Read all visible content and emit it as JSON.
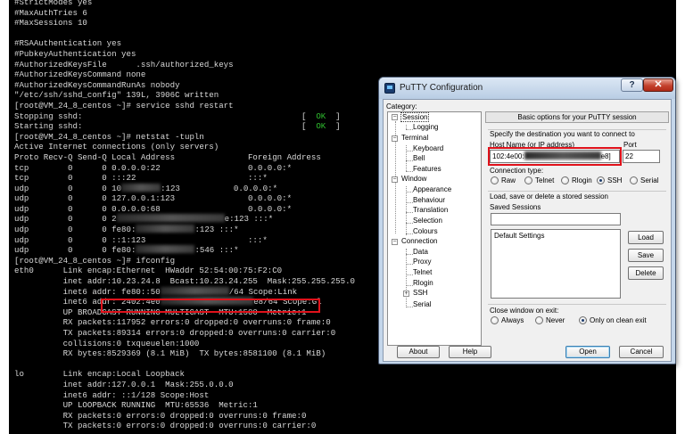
{
  "terminal": {
    "lines": [
      {
        "segs": [
          {
            "t": "#StrictModes yes"
          }
        ]
      },
      {
        "segs": [
          {
            "t": "#MaxAuthTries 6"
          }
        ]
      },
      {
        "segs": [
          {
            "t": "#MaxSessions 10"
          }
        ]
      },
      {
        "segs": [
          {
            "t": ""
          }
        ]
      },
      {
        "segs": [
          {
            "t": "#RSAAuthentication yes"
          }
        ]
      },
      {
        "segs": [
          {
            "t": "#PubkeyAuthentication yes"
          }
        ]
      },
      {
        "segs": [
          {
            "t": "#AuthorizedKeysFile      .ssh/authorized_keys"
          }
        ]
      },
      {
        "segs": [
          {
            "t": "#AuthorizedKeysCommand none"
          }
        ]
      },
      {
        "segs": [
          {
            "t": "#AuthorizedKeysCommandRunAs nobody"
          }
        ]
      },
      {
        "segs": [
          {
            "t": "\"/etc/ssh/sshd_config\" 139L, 3906C written"
          }
        ]
      },
      {
        "segs": [
          {
            "t": "[root@VM_24_8_centos ~]# service sshd restart"
          }
        ]
      },
      {
        "segs": [
          {
            "t": "Stopping sshd:                                             [  "
          },
          {
            "t": "OK",
            "ok": true
          },
          {
            "t": "  ]"
          }
        ]
      },
      {
        "segs": [
          {
            "t": "Starting sshd:                                             [  "
          },
          {
            "t": "OK",
            "ok": true
          },
          {
            "t": "  ]"
          }
        ]
      },
      {
        "segs": [
          {
            "t": "[root@VM_24_8_centos ~]# netstat -tupln"
          }
        ]
      },
      {
        "segs": [
          {
            "t": "Active Internet connections (only servers)"
          }
        ]
      },
      {
        "segs": [
          {
            "t": "Proto Recv-Q Send-Q Local Address               Foreign Address"
          }
        ]
      },
      {
        "segs": [
          {
            "t": "tcp        0      0 0.0.0.0:22                  0.0.0.0:*"
          }
        ]
      },
      {
        "segs": [
          {
            "t": "tcp        0      0 :::22                       :::*"
          }
        ]
      },
      {
        "segs": [
          {
            "t": "udp        0      0 10"
          },
          {
            "blur": 8
          },
          {
            "t": ":123           0.0.0.0:*"
          }
        ]
      },
      {
        "segs": [
          {
            "t": "udp        0      0 127.0.0.1:123               0.0.0.0:*"
          }
        ]
      },
      {
        "segs": [
          {
            "t": "udp        0      0 0.0.0.0:68                  0.0.0.0:*"
          }
        ]
      },
      {
        "segs": [
          {
            "t": "udp        0      0 2"
          },
          {
            "blur": 22
          },
          {
            "t": "e:123 :::*"
          }
        ]
      },
      {
        "segs": [
          {
            "t": "udp        0      0 fe80:"
          },
          {
            "blur": 12
          },
          {
            "t": ":123 :::*"
          }
        ]
      },
      {
        "segs": [
          {
            "t": "udp        0      0 ::1:123                     :::*"
          }
        ]
      },
      {
        "segs": [
          {
            "t": "udp        0      0 fe80:"
          },
          {
            "blur": 12
          },
          {
            "t": ":546 :::*"
          }
        ]
      },
      {
        "segs": [
          {
            "t": "[root@VM_24_8_centos ~]# ifconfig"
          }
        ]
      },
      {
        "segs": [
          {
            "t": "eth0      Link encap:Ethernet  HWaddr 52:54:00:75:F2:C0"
          }
        ]
      },
      {
        "segs": [
          {
            "t": "          inet addr:10.23.24.8  Bcast:10.23.24.255  Mask:255.255.255.0"
          }
        ]
      },
      {
        "segs": [
          {
            "t": "          inet6 addr: fe80::50"
          },
          {
            "blur": 14
          },
          {
            "t": "/64 Scope:Link"
          }
        ]
      },
      {
        "segs": [
          {
            "t": "          inet6 addr: 2402:4e0"
          },
          {
            "blur": 19
          },
          {
            "t": "e8/64 Scope:Gl"
          }
        ]
      },
      {
        "segs": [
          {
            "t": "          UP BROADCAST RUNNING MULTICAST  MTU:1500  Metric:1"
          }
        ]
      },
      {
        "segs": [
          {
            "t": "          RX packets:117952 errors:0 dropped:0 overruns:0 frame:0"
          }
        ]
      },
      {
        "segs": [
          {
            "t": "          TX packets:89314 errors:0 dropped:0 overruns:0 carrier:0"
          }
        ]
      },
      {
        "segs": [
          {
            "t": "          collisions:0 txqueuelen:1000"
          }
        ]
      },
      {
        "segs": [
          {
            "t": "          RX bytes:8529369 (8.1 MiB)  TX bytes:8581100 (8.1 MiB)"
          }
        ]
      },
      {
        "segs": [
          {
            "t": ""
          }
        ]
      },
      {
        "segs": [
          {
            "t": "lo        Link encap:Local Loopback"
          }
        ]
      },
      {
        "segs": [
          {
            "t": "          inet addr:127.0.0.1  Mask:255.0.0.0"
          }
        ]
      },
      {
        "segs": [
          {
            "t": "          inet6 addr: ::1/128 Scope:Host"
          }
        ]
      },
      {
        "segs": [
          {
            "t": "          UP LOOPBACK RUNNING  MTU:65536  Metric:1"
          }
        ]
      },
      {
        "segs": [
          {
            "t": "          RX packets:0 errors:0 dropped:0 overruns:0 frame:0"
          }
        ]
      },
      {
        "segs": [
          {
            "t": "          TX packets:0 errors:0 dropped:0 overruns:0 carrier:0"
          }
        ]
      }
    ]
  },
  "putty": {
    "title": "PuTTY Configuration",
    "help_glyph": "?",
    "close_glyph": "✕",
    "category_label": "Category:",
    "tree": {
      "session": "Session",
      "logging": "Logging",
      "terminal": "Terminal",
      "keyboard": "Keyboard",
      "bell": "Bell",
      "features": "Features",
      "window": "Window",
      "appearance": "Appearance",
      "behaviour": "Behaviour",
      "translation": "Translation",
      "selection": "Selection",
      "colours": "Colours",
      "connection": "Connection",
      "data": "Data",
      "proxy": "Proxy",
      "telnet": "Telnet",
      "rlogin": "Rlogin",
      "ssh": "SSH",
      "serial": "Serial"
    },
    "panel_title": "Basic options for your PuTTY session",
    "destination_label": "Specify the destination you want to connect to",
    "host_label": "Host Name (or IP address)",
    "host_value_start": "102:4e00:",
    "host_value_end": "e8]",
    "port_label": "Port",
    "port_value": "22",
    "conn_type_label": "Connection type:",
    "conn_types": {
      "raw": "Raw",
      "telnet": "Telnet",
      "rlogin": "Rlogin",
      "ssh": "SSH",
      "serial": "Serial"
    },
    "selected_conn_type": "SSH",
    "load_save_label": "Load, save or delete a stored session",
    "saved_sessions_label": "Saved Sessions",
    "saved_session_value": "",
    "sessions": [
      "Default Settings"
    ],
    "load_btn": "Load",
    "save_btn": "Save",
    "delete_btn": "Delete",
    "close_window_label": "Close window on exit:",
    "exit_options": {
      "always": "Always",
      "never": "Never",
      "clean": "Only on clean exit"
    },
    "selected_exit_option": "Only on clean exit",
    "about_btn": "About",
    "help_btn": "Help",
    "open_btn": "Open",
    "cancel_btn": "Cancel"
  },
  "colors": {
    "highlight": "#e0121b",
    "terminal_bg": "#000000",
    "terminal_fg": "#d8d8d8",
    "ok_green": "#2fbf2f"
  }
}
